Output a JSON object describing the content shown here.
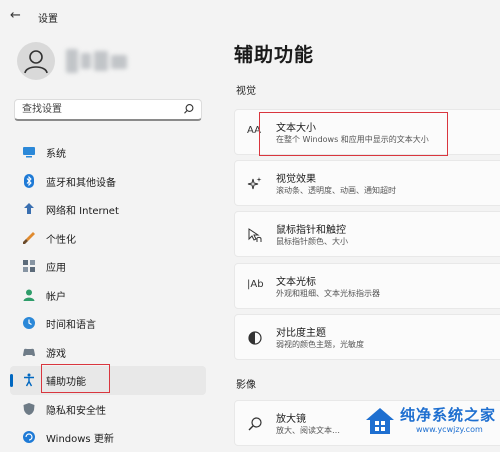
{
  "window": {
    "title": "设置",
    "back_glyph": "←"
  },
  "search": {
    "placeholder": "查找设置"
  },
  "nav": {
    "items": [
      {
        "id": "system",
        "label": "系统"
      },
      {
        "id": "bluetooth",
        "label": "蓝牙和其他设备"
      },
      {
        "id": "network",
        "label": "网络和 Internet"
      },
      {
        "id": "personalization",
        "label": "个性化"
      },
      {
        "id": "apps",
        "label": "应用"
      },
      {
        "id": "accounts",
        "label": "帐户"
      },
      {
        "id": "time-language",
        "label": "时间和语言"
      },
      {
        "id": "gaming",
        "label": "游戏"
      },
      {
        "id": "accessibility",
        "label": "辅助功能",
        "active": true
      },
      {
        "id": "privacy",
        "label": "隐私和安全性"
      },
      {
        "id": "windows-update",
        "label": "Windows 更新"
      }
    ]
  },
  "main": {
    "title": "辅助功能",
    "sections": [
      {
        "label": "视觉"
      },
      {
        "label": "影像"
      }
    ],
    "cards": [
      {
        "id": "text-size",
        "title": "文本大小",
        "subtitle": "在整个 Windows 和应用中显示的文本大小",
        "icon": "text-size-icon",
        "icon_glyph": "AA"
      },
      {
        "id": "visual-effects",
        "title": "视觉效果",
        "subtitle": "滚动条、透明度、动画、通知超时",
        "icon": "sparkle-icon"
      },
      {
        "id": "mouse-pointer",
        "title": "鼠标指针和触控",
        "subtitle": "鼠标指针颜色、大小",
        "icon": "pointer-icon"
      },
      {
        "id": "text-cursor",
        "title": "文本光标",
        "subtitle": "外观和粗细、文本光标指示器",
        "icon": "text-cursor-icon",
        "icon_glyph": "|Ab"
      },
      {
        "id": "contrast-themes",
        "title": "对比度主题",
        "subtitle": "弱视的颜色主题，光敏度",
        "icon": "contrast-icon"
      },
      {
        "id": "magnifier",
        "title": "放大镜",
        "subtitle": "放大、阅读文本…",
        "icon": "magnifier-icon"
      }
    ]
  },
  "watermark": {
    "name": "纯净系统之家",
    "url": "www.ycwjzy.com"
  },
  "colors": {
    "accent": "#0067c0",
    "highlight": "#d9363e",
    "watermark": "#1e6fd0"
  }
}
